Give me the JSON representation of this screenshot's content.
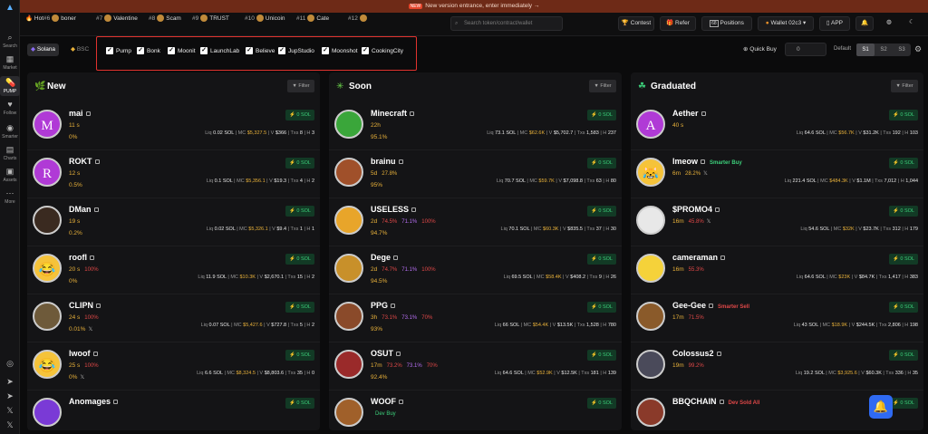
{
  "banner": {
    "badge": "NEW",
    "text": "New version entrance, enter immediately →"
  },
  "hot": {
    "label": "Hot",
    "items": [
      {
        "rank": "#6",
        "name": "boner"
      },
      {
        "rank": "#7",
        "name": "Valentine"
      },
      {
        "rank": "#8",
        "name": "Scam"
      },
      {
        "rank": "#9",
        "name": "TRUST"
      },
      {
        "rank": "#10",
        "name": "Unicoin"
      },
      {
        "rank": "#11",
        "name": "Cate"
      },
      {
        "rank": "#12",
        "name": "‌"
      }
    ]
  },
  "search_placeholder": "Search token/contract/wallet",
  "topbar": {
    "contest": "Contest",
    "refer": "Refer",
    "positions_count": "68",
    "positions": "Positions",
    "wallet": "Wallet 02c3",
    "app": "APP"
  },
  "sidebar": {
    "items": [
      "Search",
      "Market",
      "PUMP",
      "Follow",
      "Smarter",
      "Charts",
      "Assets",
      "More"
    ]
  },
  "chains": {
    "solana": "Solana",
    "bsc": "BSC"
  },
  "launchpads": [
    "Pump",
    "Bonk",
    "Moonit",
    "LaunchLab",
    "Believe",
    "JupStudio",
    "Moonshot",
    "CookingCity"
  ],
  "quickbuy": {
    "label": "Quick Buy",
    "value": "0",
    "default": "Default",
    "s1": "S1",
    "s2": "S2",
    "s3": "S3"
  },
  "filter_label": "Filter",
  "buy_label": "0 SOL",
  "colors": {
    "accent": "#e8b13a",
    "green": "#3ccf7a",
    "red": "#e04848",
    "bell": "#2f6af2"
  },
  "columns": [
    {
      "title": "New",
      "rows": [
        {
          "name": "mai",
          "age": "11 s",
          "tags": [],
          "pct": "0%",
          "social": "",
          "liq": "0.02 SOL",
          "mc": "$5,327.5",
          "v": "$366",
          "txs": "8",
          "h": "3",
          "avatar": "M",
          "avcolor": "#b03ad6"
        },
        {
          "name": "ROKT",
          "age": "12 s",
          "tags": [],
          "pct": "0.5%",
          "social": "",
          "liq": "0.1 SOL",
          "mc": "$5,356.1",
          "v": "$19.3",
          "txs": "4",
          "h": "2",
          "avatar": "R",
          "avcolor": "#b03ad6"
        },
        {
          "name": "DMan",
          "age": "19 s",
          "tags": [],
          "pct": "0.2%",
          "social": "",
          "liq": "0.02 SOL",
          "mc": "$5,326.1",
          "v": "$9.4",
          "txs": "1",
          "h": "1",
          "avatar": "",
          "avcolor": "#3a2a20"
        },
        {
          "name": "roofl",
          "age": "20 s",
          "tags": [
            {
              "t": "100%",
              "c": "red"
            }
          ],
          "pct": "0%",
          "social": "",
          "liq": "11.9 SOL",
          "mc": "$10.3K",
          "v": "$2,670.1",
          "txs": "15",
          "h": "2",
          "avatar": "😂",
          "avcolor": "#f5c33a"
        },
        {
          "name": "CLIPN",
          "age": "24 s",
          "tags": [
            {
              "t": "100%",
              "c": "red"
            }
          ],
          "pct": "0.01%",
          "social": "𝕏",
          "liq": "0.07 SOL",
          "mc": "$5,427.6",
          "v": "$727.8",
          "txs": "5",
          "h": "2",
          "avatar": "",
          "avcolor": "#6e5a3a"
        },
        {
          "name": "lwoof",
          "age": "25 s",
          "tags": [
            {
              "t": "100%",
              "c": "red"
            }
          ],
          "pct": "0%",
          "social": "𝕏",
          "liq": "6.6 SOL",
          "mc": "$8,324.5",
          "v": "$8,803.6",
          "txs": "35",
          "h": "0",
          "avatar": "😂",
          "avcolor": "#f5c33a"
        },
        {
          "name": "Anomages",
          "age": "",
          "tags": [],
          "pct": "",
          "social": "",
          "liq": "",
          "mc": "",
          "v": "",
          "txs": "",
          "h": "",
          "avatar": "",
          "avcolor": "#7a3ad6"
        }
      ]
    },
    {
      "title": "Soon",
      "rows": [
        {
          "name": "Minecraft",
          "age": "22h",
          "tags": [],
          "pct": "95.1%",
          "social": "",
          "liq": "73.1 SOL",
          "mc": "$62.6K",
          "v": "$5,702.7",
          "txs": "1,583",
          "h": "237",
          "avatar": "",
          "avcolor": "#3aa63a"
        },
        {
          "name": "brainu",
          "age": "5d",
          "tags": [
            {
              "t": "27.8%",
              "c": ""
            }
          ],
          "pct": "95%",
          "social": "",
          "liq": "70.7 SOL",
          "mc": "$59.7K",
          "v": "$7,098.8",
          "txs": "63",
          "h": "80",
          "avatar": "",
          "avcolor": "#a0502a"
        },
        {
          "name": "USELESS",
          "age": "2d",
          "tags": [
            {
              "t": "74.5%",
              "c": "red"
            },
            {
              "t": "71.1%",
              "c": "pur"
            },
            {
              "t": "100%",
              "c": "red"
            }
          ],
          "pct": "94.7%",
          "social": "",
          "liq": "70.1 SOL",
          "mc": "$60.3K",
          "v": "$835.5",
          "txs": "37",
          "h": "30",
          "avatar": "",
          "avcolor": "#e8a52a"
        },
        {
          "name": "Dege",
          "age": "2d",
          "tags": [
            {
              "t": "74.7%",
              "c": "red"
            },
            {
              "t": "71.1%",
              "c": "pur"
            },
            {
              "t": "100%",
              "c": "red"
            }
          ],
          "pct": "94.5%",
          "social": "",
          "liq": "69.5 SOL",
          "mc": "$58.4K",
          "v": "$408.2",
          "txs": "9",
          "h": "26",
          "avatar": "",
          "avcolor": "#c8902a"
        },
        {
          "name": "PPG",
          "age": "3h",
          "tags": [
            {
              "t": "73.1%",
              "c": "red"
            },
            {
              "t": "73.1%",
              "c": "pur"
            },
            {
              "t": "70%",
              "c": "red"
            }
          ],
          "pct": "93%",
          "social": "",
          "liq": "66 SOL",
          "mc": "$54.4K",
          "v": "$13.5K",
          "txs": "1,528",
          "h": "780",
          "avatar": "",
          "avcolor": "#8a4a2a"
        },
        {
          "name": "OSUT",
          "age": "17m",
          "tags": [
            {
              "t": "73.2%",
              "c": "red"
            },
            {
              "t": "73.1%",
              "c": "pur"
            },
            {
              "t": "70%",
              "c": "red"
            }
          ],
          "pct": "92.4%",
          "social": "",
          "liq": "64.6 SOL",
          "mc": "$52.9K",
          "v": "$12.5K",
          "txs": "181",
          "h": "139",
          "avatar": "",
          "avcolor": "#9a2a2a"
        },
        {
          "name": "WOOF",
          "age": "",
          "tags": [
            {
              "t": "Dev Buy",
              "c": "grn"
            }
          ],
          "pct": "",
          "social": "",
          "liq": "",
          "mc": "",
          "v": "",
          "txs": "",
          "h": "",
          "avatar": "",
          "avcolor": "#a0602a"
        }
      ]
    },
    {
      "title": "Graduated",
      "rows": [
        {
          "name": "Aether",
          "age": "40 s",
          "tags": [],
          "pct": "",
          "social": "",
          "liq": "64.6 SOL",
          "mc": "$56.7K",
          "v": "$31.2K",
          "txs": "192",
          "h": "103",
          "avatar": "A",
          "avcolor": "#b03ad6"
        },
        {
          "name": "lmeow",
          "age": "6m",
          "tags": [
            {
              "t": "28.2%",
              "c": ""
            }
          ],
          "pct": "",
          "social": "𝕏",
          "liq": "221.4 SOL",
          "mc": "$484.3K",
          "v": "$1.1M",
          "txs": "7,012",
          "h": "1,044",
          "avatar": "😹",
          "avcolor": "#f5c33a",
          "badge": "Smarter Buy",
          "badgeC": "grn"
        },
        {
          "name": "$PROMO4",
          "age": "16m",
          "tags": [
            {
              "t": "45.8%",
              "c": "red"
            }
          ],
          "pct": "",
          "social": "𝕏",
          "liq": "54.6 SOL",
          "mc": "$32K",
          "v": "$23.7K",
          "txs": "312",
          "h": "179",
          "avatar": "",
          "avcolor": "#e8e8e8"
        },
        {
          "name": "cameraman",
          "age": "16m",
          "tags": [
            {
              "t": "55.3%",
              "c": "red"
            }
          ],
          "pct": "",
          "social": "",
          "liq": "64.6 SOL",
          "mc": "$23K",
          "v": "$84.7K",
          "txs": "1,417",
          "h": "383",
          "avatar": "",
          "avcolor": "#f5d23a"
        },
        {
          "name": "Gee-Gee",
          "age": "17m",
          "tags": [
            {
              "t": "71.5%",
              "c": "red"
            }
          ],
          "pct": "",
          "social": "",
          "liq": "43 SOL",
          "mc": "$18.9K",
          "v": "$244.5K",
          "txs": "2,806",
          "h": "198",
          "avatar": "",
          "avcolor": "#8a5a2a",
          "badge": "Smarter Sell",
          "badgeC": "red"
        },
        {
          "name": "Colossus2",
          "age": "19m",
          "tags": [
            {
              "t": "99.2%",
              "c": "red"
            }
          ],
          "pct": "",
          "social": "",
          "liq": "19.2 SOL",
          "mc": "$3,925.6",
          "v": "$60.3K",
          "txs": "336",
          "h": "35",
          "avatar": "",
          "avcolor": "#4a4a5a"
        },
        {
          "name": "BBQCHAIN",
          "age": "",
          "tags": [],
          "pct": "",
          "social": "",
          "liq": "",
          "mc": "",
          "v": "",
          "txs": "",
          "h": "",
          "avatar": "",
          "avcolor": "#8a3a2a",
          "badge": "Dev Sold All",
          "badgeC": "red"
        }
      ]
    }
  ]
}
